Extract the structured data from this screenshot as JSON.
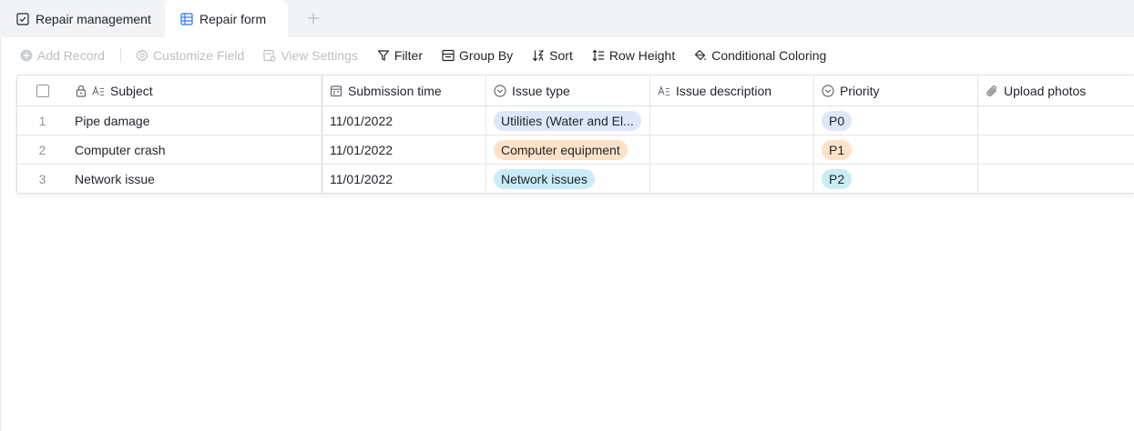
{
  "tabs": [
    {
      "label": "Repair management",
      "icon": "checkbox-icon",
      "active": false
    },
    {
      "label": "Repair form",
      "icon": "grid-table-icon",
      "active": true
    }
  ],
  "tab_add": {
    "icon": "plus-icon"
  },
  "toolbar": {
    "add_record": "Add Record",
    "customize_field": "Customize Field",
    "view_settings": "View Settings",
    "filter": "Filter",
    "group_by": "Group By",
    "sort": "Sort",
    "row_height": "Row Height",
    "conditional_coloring": "Conditional Coloring"
  },
  "columns": {
    "subject": "Subject",
    "submission_time": "Submission time",
    "issue_type": "Issue type",
    "issue_description": "Issue description",
    "priority": "Priority",
    "upload_photos": "Upload photos"
  },
  "rows": [
    {
      "index": "1",
      "subject": "Pipe damage",
      "submission_time": "11/01/2022",
      "issue_type": "Utilities (Water and El...",
      "issue_description": "",
      "priority": "P0",
      "upload_photos": ""
    },
    {
      "index": "2",
      "subject": "Computer crash",
      "submission_time": "11/01/2022",
      "issue_type": "Computer equipment",
      "issue_description": "",
      "priority": "P1",
      "upload_photos": ""
    },
    {
      "index": "3",
      "subject": "Network issue",
      "submission_time": "11/01/2022",
      "issue_type": "Network issues",
      "issue_description": "",
      "priority": "P2",
      "upload_photos": ""
    }
  ],
  "colors": {
    "accent": "#3370ff",
    "tag_blue": "#dde6fb",
    "tag_orange": "#fde2c8",
    "tag_cyan": "#c9ecf7"
  }
}
